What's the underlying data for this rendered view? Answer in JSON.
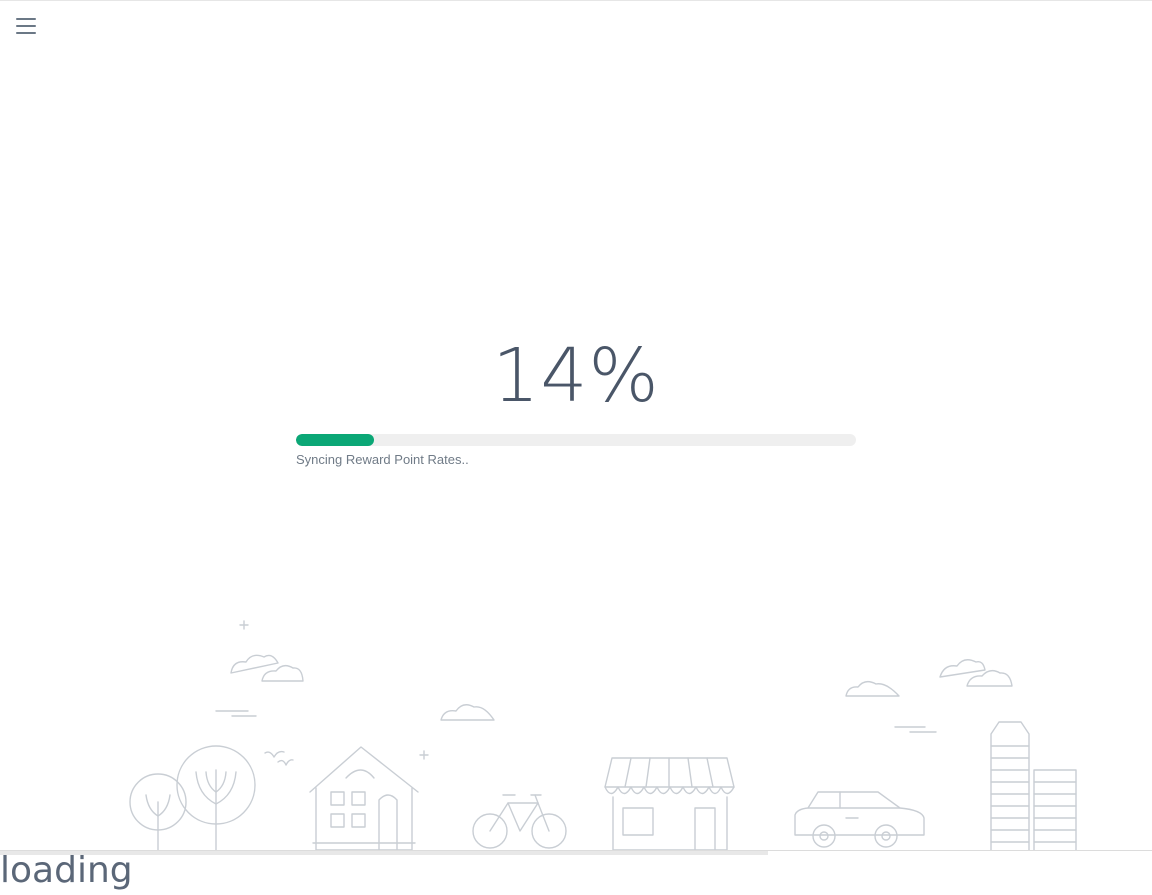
{
  "header": {
    "menu_icon": "hamburger-menu-icon"
  },
  "loader": {
    "percent_text": "14%",
    "progress_value": 0.14,
    "status_text": "Syncing Reward Point Rates..",
    "accent_color": "#0ba776",
    "track_color": "#efefef"
  },
  "footer": {
    "loading_text": "loading"
  },
  "illustration": {
    "items": [
      "cloud-icon",
      "tree-icon",
      "house-icon",
      "bicycle-icon",
      "shop-icon",
      "car-icon",
      "building-icon",
      "bird-icon",
      "star-icon"
    ],
    "stroke_color": "#c9ced4"
  }
}
